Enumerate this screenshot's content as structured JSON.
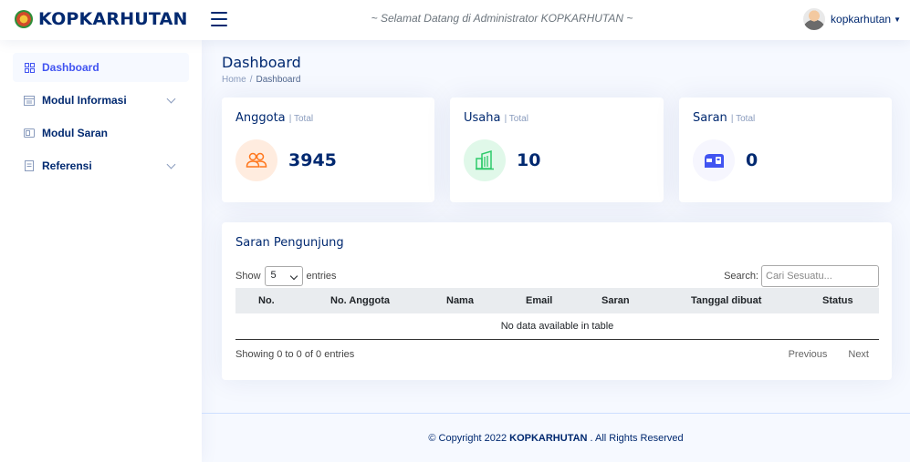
{
  "header": {
    "brand": "KOPKARHUTAN",
    "welcome": "~ Selamat Datang di Administrator KOPKARHUTAN ~",
    "user": "kopkarhutan"
  },
  "sidebar": {
    "items": [
      {
        "label": "Dashboard",
        "icon": "grid-icon",
        "active": true
      },
      {
        "label": "Modul Informasi",
        "icon": "layout-text-icon",
        "expandable": true
      },
      {
        "label": "Modul Saran",
        "icon": "card-icon"
      },
      {
        "label": "Referensi",
        "icon": "journal-icon",
        "expandable": true
      }
    ]
  },
  "page": {
    "title": "Dashboard",
    "breadcrumb": {
      "home": "Home",
      "sep": "/",
      "current": "Dashboard"
    }
  },
  "stats": [
    {
      "title": "Anggota",
      "sub": "| Total",
      "value": "3945",
      "icon": "people-icon",
      "color": "#ff771d",
      "bg": "#ffecdf"
    },
    {
      "title": "Usaha",
      "sub": "| Total",
      "value": "10",
      "icon": "building-icon",
      "color": "#2eca6a",
      "bg": "#e0f8e9"
    },
    {
      "title": "Saran",
      "sub": "| Total",
      "value": "0",
      "icon": "mailbox-icon",
      "color": "#4154f1",
      "bg": "#f6f6fe"
    }
  ],
  "table": {
    "title": "Saran Pengunjung",
    "show_label": "Show",
    "entries_value": "5",
    "entries_label": "entries",
    "search_label": "Search:",
    "search_placeholder": "Cari Sesuatu...",
    "columns": [
      "No.",
      "No. Anggota",
      "Nama",
      "Email",
      "Saran",
      "Tanggal dibuat",
      "Status"
    ],
    "empty": "No data available in table",
    "showing": "Showing 0 to 0 of 0 entries",
    "previous": "Previous",
    "next": "Next"
  },
  "footer": {
    "prefix": "© Copyright 2022",
    "brand": "KOPKARHUTAN",
    "suffix": ". All Rights Reserved"
  }
}
